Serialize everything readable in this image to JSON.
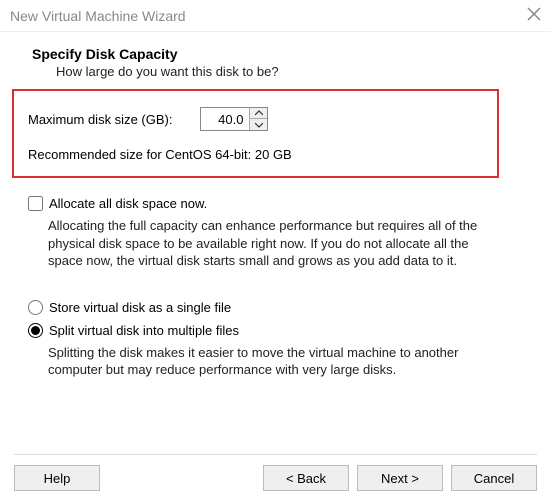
{
  "titlebar": {
    "title": "New Virtual Machine Wizard"
  },
  "heading": "Specify Disk Capacity",
  "subheading": "How large do you want this disk to be?",
  "disk": {
    "label": "Maximum disk size (GB):",
    "value": "40.0",
    "recommended": "Recommended size for CentOS 64-bit: 20 GB"
  },
  "allocate": {
    "label": "Allocate all disk space now.",
    "desc": "Allocating the full capacity can enhance performance but requires all of the physical disk space to be available right now. If you do not allocate all the space now, the virtual disk starts small and grows as you add data to it."
  },
  "storage": {
    "single": "Store virtual disk as a single file",
    "split": "Split virtual disk into multiple files",
    "desc": "Splitting the disk makes it easier to move the virtual machine to another computer but may reduce performance with very large disks."
  },
  "buttons": {
    "help": "Help",
    "back": "< Back",
    "next": "Next >",
    "cancel": "Cancel"
  }
}
